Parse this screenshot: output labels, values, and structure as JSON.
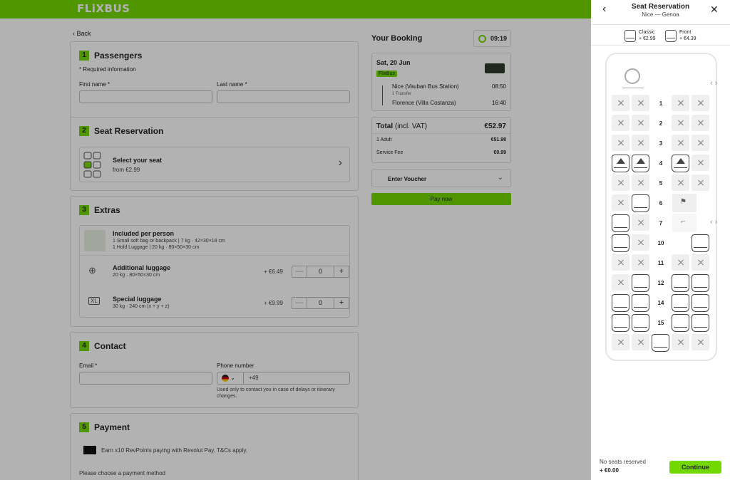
{
  "header": {
    "logo": "FLiXBUS",
    "brand_color": "#73d700"
  },
  "back_label": "Back",
  "passengers": {
    "number": "1",
    "title": "Passengers",
    "required_note": "* Required information",
    "first_name_label": "First name *",
    "last_name_label": "Last name *"
  },
  "seat_section": {
    "number": "2",
    "title": "Seat Reservation",
    "card_title": "Select your seat",
    "card_sub": "from €2.99"
  },
  "extras": {
    "number": "3",
    "title": "Extras",
    "included_title": "Included per person",
    "included_line1": "1 Small soft bag or backpack | 7 kg · 42×30×18 cm",
    "included_line2": "1 Hold Luggage | 20 kg · 80×50×30 cm",
    "additional_title": "Additional luggage",
    "additional_sub": "20 kg · 80×50×30 cm",
    "additional_price": "+ €6.49",
    "additional_qty": "0",
    "special_title": "Special luggage",
    "special_sub": "30 kg · 240 cm (x + y + z)",
    "special_price": "+ €9.99",
    "special_qty": "0"
  },
  "contact": {
    "number": "4",
    "title": "Contact",
    "email_label": "Email *",
    "phone_label": "Phone number",
    "phone_prefix": "+49",
    "phone_note": "Used only to contact you in case of delays or itinerary changes."
  },
  "payment": {
    "number": "5",
    "title": "Payment",
    "revolut_text": "Earn x10 RevPoints paying with Revolut Pay. T&Cs apply.",
    "choose_label": "Please choose a payment method"
  },
  "booking": {
    "title": "Your Booking",
    "timer": "09:19",
    "date": "Sat, 20 Jun",
    "operator": "FlixBus",
    "from_station": "Nice (Vauban Bus Station)",
    "from_time": "08:50",
    "transfer": "1 Transfer",
    "to_station": "Florence (Villa Costanza)",
    "to_time": "16:40",
    "total_label": "Total",
    "total_vat": "(incl. VAT)",
    "total_value": "€52.97",
    "adult_label": "1 Adult",
    "adult_value": "€51.98",
    "fee_label": "Service Fee",
    "fee_value": "€0.99",
    "voucher_label": "Enter Voucher",
    "pay_label": "Pay now"
  },
  "panel": {
    "title": "Seat Reservation",
    "subtitle": "Nice — Genoa",
    "classic_label": "Classic",
    "classic_price": "+ €2.99",
    "front_label": "Front",
    "front_price": "+ €4.39",
    "rows": [
      "1",
      "2",
      "3",
      "4",
      "5",
      "6",
      "7",
      "10",
      "11",
      "12",
      "14",
      "15"
    ],
    "footer_status": "No seats reserved",
    "footer_price": "+ €0.00",
    "continue_label": "Continue"
  }
}
